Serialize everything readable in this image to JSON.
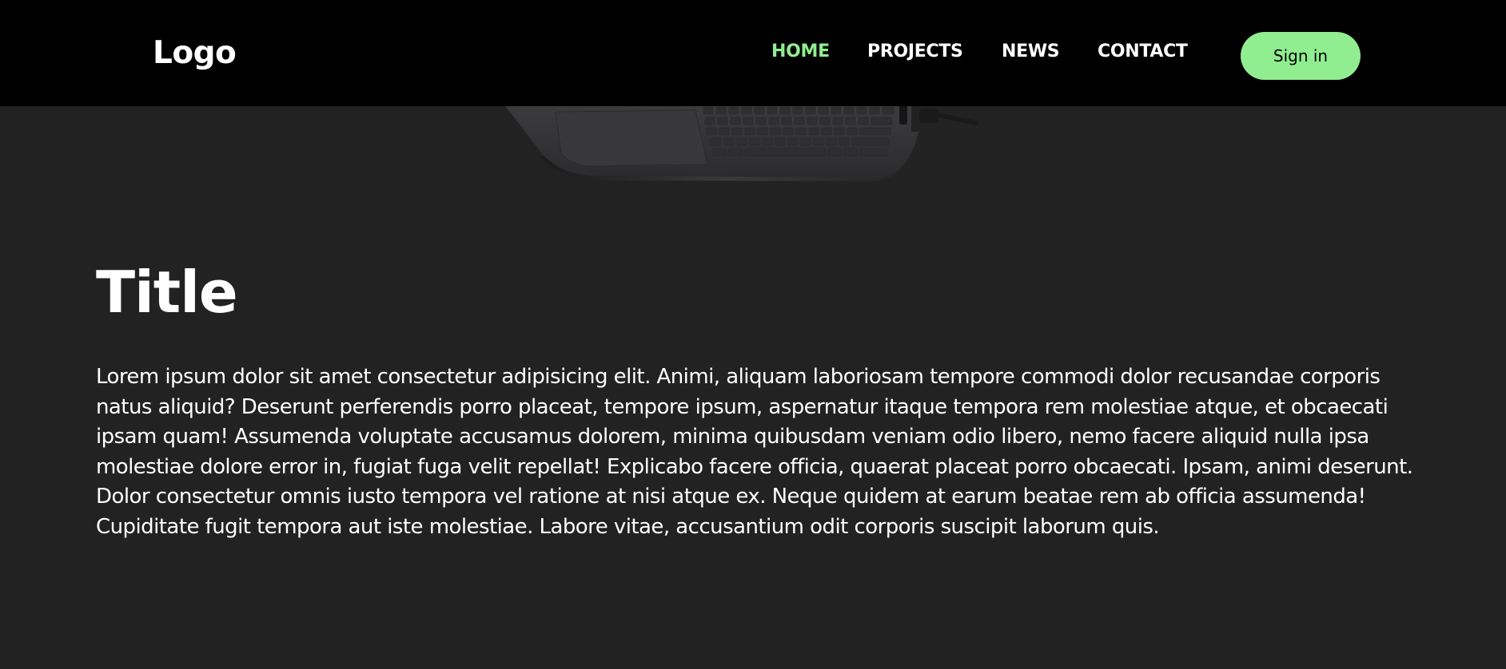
{
  "nav": {
    "logo": "Logo",
    "links": [
      {
        "label": "HOME",
        "active": true
      },
      {
        "label": "PROJECTS",
        "active": false
      },
      {
        "label": "NEWS",
        "active": false
      },
      {
        "label": "CONTACT",
        "active": false
      }
    ],
    "signin_label": "Sign in"
  },
  "hero": {
    "image": "laptop-keyboard"
  },
  "main": {
    "title": "Title",
    "body": "Lorem ipsum dolor sit amet consectetur adipisicing elit. Animi, aliquam laboriosam tempore commodi dolor recusandae corporis natus aliquid? Deserunt perferendis porro placeat, tempore ipsum, aspernatur itaque tempora rem molestiae atque, et obcaecati ipsam quam! Assumenda voluptate accusamus dolorem, minima quibusdam veniam odio libero, nemo facere aliquid nulla ipsa molestiae dolore error in, fugiat fuga velit repellat! Explicabo facere officia, quaerat placeat porro obcaecati. Ipsam, animi deserunt. Dolor consectetur omnis iusto tempora vel ratione at nisi atque ex. Neque quidem at earum beatae rem ab officia assumenda! Cupiditate fugit tempora aut iste molestiae. Labore vitae, accusantium odit corporis suscipit laborum quis."
  },
  "colors": {
    "page_background": "#222222",
    "nav_background": "#000000",
    "accent": "#90ee90",
    "text": "#ffffff"
  }
}
